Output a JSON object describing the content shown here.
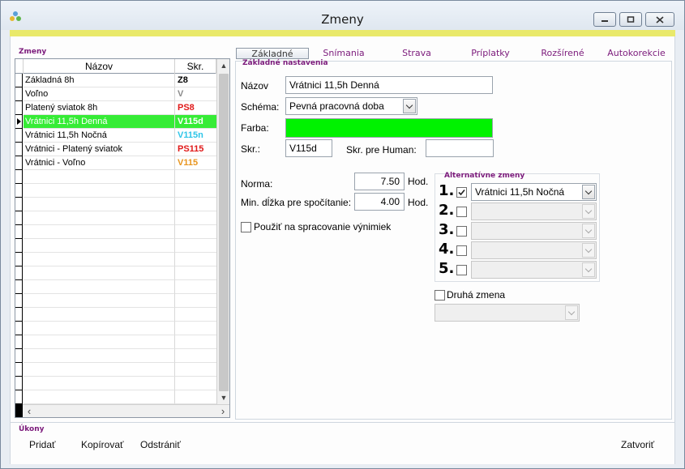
{
  "window": {
    "title": "Zmeny"
  },
  "left_group": {
    "label": "Zmeny",
    "columns": [
      "Názov",
      "Skr."
    ],
    "rows": [
      {
        "name": "Základná 8h",
        "code": "Z8",
        "code_color": "#000000"
      },
      {
        "name": "Voľno",
        "code": "V",
        "code_color": "#8a8a8a"
      },
      {
        "name": "Platený sviatok 8h",
        "code": "PS8",
        "code_color": "#e01919"
      },
      {
        "name": "Vrátnici 11,5h Denná",
        "code": "V115d",
        "code_color": "#ffffff"
      },
      {
        "name": "Vrátnici 11,5h Nočná",
        "code": "V115n",
        "code_color": "#2ec5e8"
      },
      {
        "name": "Vrátnici - Platený sviatok",
        "code": "PS115",
        "code_color": "#e01919"
      },
      {
        "name": "Vrátnici - Voľno",
        "code": "V115",
        "code_color": "#e8951e"
      }
    ],
    "selected_index": 3
  },
  "tabs": [
    {
      "label": "Základné",
      "active": true
    },
    {
      "label": "Snímania",
      "active": false
    },
    {
      "label": "Strava",
      "active": false
    },
    {
      "label": "Príplatky",
      "active": false
    },
    {
      "label": "Rozšírené",
      "active": false
    },
    {
      "label": "Autokorekcie",
      "active": false
    }
  ],
  "basic": {
    "group_label": "Základné nastavenia",
    "name_label": "Názov",
    "name_value": "Vrátnici 11,5h Denná",
    "schema_label": "Schéma:",
    "schema_value": "Pevná pracovná doba",
    "color_label": "Farba:",
    "color_value": "#00f200",
    "code_label": "Skr.:",
    "code_value": "V115d",
    "human_label": "Skr. pre Human:",
    "human_value": "",
    "norm_label": "Norma:",
    "norm_value": "7.50",
    "norm_unit": "Hod.",
    "min_label": "Min. dĺžka pre spočítanie:",
    "min_value": "4.00",
    "min_unit": "Hod.",
    "exceptions_label": "Použiť na spracovanie výnimiek",
    "exceptions_checked": false
  },
  "alternatives": {
    "label": "Alternatívne zmeny",
    "items": [
      {
        "num": "1.",
        "checked": true,
        "value": "Vrátnici 11,5h Nočná"
      },
      {
        "num": "2.",
        "checked": false,
        "value": ""
      },
      {
        "num": "3.",
        "checked": false,
        "value": ""
      },
      {
        "num": "4.",
        "checked": false,
        "value": ""
      },
      {
        "num": "5.",
        "checked": false,
        "value": ""
      }
    ],
    "second_shift_label": "Druhá zmena",
    "second_shift_checked": false,
    "second_shift_value": ""
  },
  "actions": {
    "label": "Úkony",
    "add": "Pridať",
    "copy": "Kopírovať",
    "remove": "Odstrániť",
    "close": "Zatvoriť"
  }
}
